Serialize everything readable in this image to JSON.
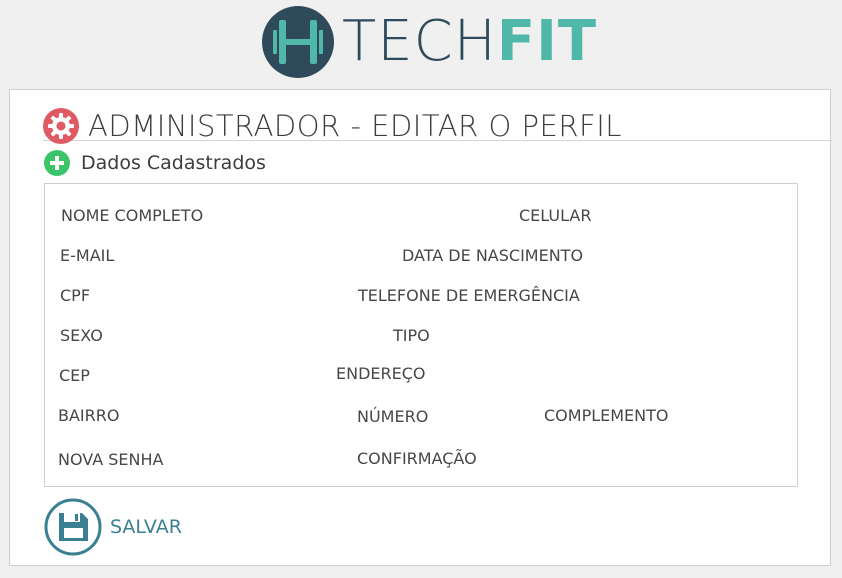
{
  "brand": {
    "logo_text_light": "TECH",
    "logo_text_bold": "FIT",
    "badge_letter": "H",
    "colors": {
      "dark": "#2f4a5b",
      "accent": "#4fb8a8"
    }
  },
  "header": {
    "title": "ADMINISTRADOR - EDITAR O PERFIL",
    "icon": "gear-icon",
    "icon_color": "#e05a63"
  },
  "section": {
    "label": "Dados Cadastrados",
    "icon": "plus-circle-icon",
    "icon_color": "#3cc46a"
  },
  "form": {
    "fields": [
      "NOME COMPLETO",
      "CELULAR",
      "E-MAIL",
      "DATA DE NASCIMENTO",
      "CPF",
      "TELEFONE DE EMERGÊNCIA",
      "SEXO",
      "TIPO",
      "CEP",
      "ENDEREÇO",
      "BAIRRO",
      "NÚMERO",
      "COMPLEMENTO",
      "NOVA SENHA",
      "CONFIRMAÇÃO"
    ]
  },
  "actions": {
    "save_label": "SALVAR",
    "save_icon": "floppy-disk-icon",
    "save_color": "#3a7f92"
  }
}
